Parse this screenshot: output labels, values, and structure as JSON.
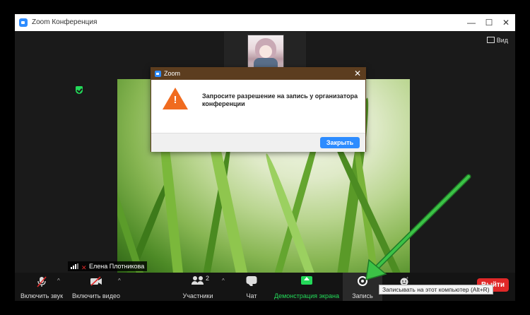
{
  "window": {
    "title": "Zoom Конференция",
    "minimize": "—",
    "maximize": "☐",
    "close": "✕"
  },
  "view_button": "Вид",
  "participant_name": "Елена Плотникова",
  "dialog": {
    "title": "Zoom",
    "close": "✕",
    "message": "Запросите разрешение на запись у организатора конференции",
    "button": "Закрыть",
    "icon_mark": "!"
  },
  "toolbar": {
    "unmute": "Включить звук",
    "start_video": "Включить видео",
    "participants": "Участники",
    "participants_count": "2",
    "chat": "Чат",
    "share_screen": "Демонстрация экрана",
    "record": "Запись",
    "leave": "Выйти",
    "caret": "^"
  },
  "tooltip": "Записывать на этот компьютер (Alt+R)",
  "colors": {
    "accent": "#2d8cff",
    "share": "#23d959",
    "leave": "#e02828",
    "warning": "#f06b1f",
    "dialog_titlebar": "#5c3d1f",
    "annotation_arrow": "#2fb03a"
  }
}
